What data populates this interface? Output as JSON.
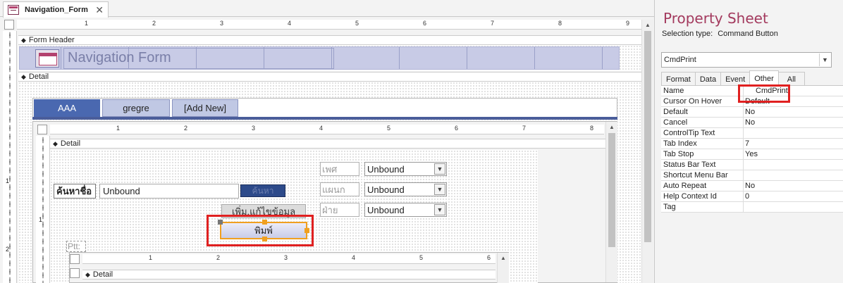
{
  "document_tab": {
    "title": "Navigation_Form",
    "close": "✕"
  },
  "ruler_numbers": [
    "1",
    "2",
    "3",
    "4",
    "5",
    "6",
    "7",
    "8",
    "9"
  ],
  "inner_ruler_numbers": [
    "1",
    "2",
    "3",
    "4",
    "5",
    "6",
    "7",
    "8"
  ],
  "sub_ruler_numbers": [
    "1",
    "2",
    "3",
    "4",
    "5",
    "6"
  ],
  "vruler_numbers": [
    "1",
    "2"
  ],
  "inner_vruler_numbers": [
    "1"
  ],
  "sections": {
    "form_header": "Form Header",
    "detail": "Detail",
    "inner_detail": "Detail",
    "sub_detail": "Detail"
  },
  "form_title": "Navigation Form",
  "nav_tabs": [
    "AAA",
    "gregre",
    "[Add New]"
  ],
  "subform": {
    "search_label": "ค้นหาชื่อ",
    "search_value": "Unbound",
    "search_button": "ค้นหา",
    "edit_button": "เพิ่ม,แก้ไขข้อมูล",
    "print_button": "พิมพ์",
    "pt_label": "Ptt:",
    "combos": [
      {
        "label": "เพศ",
        "value": "Unbound"
      },
      {
        "label": "แผนก",
        "value": "Unbound"
      },
      {
        "label": "ฝ่าย",
        "value": "Unbound"
      }
    ]
  },
  "property_sheet": {
    "title": "Property Sheet",
    "selection_type_label": "Selection type:",
    "selection_type_value": "Command Button",
    "selected_control": "CmdPrint",
    "tabs": [
      "Format",
      "Data",
      "Event",
      "Other",
      "All"
    ],
    "active_tab": "Other",
    "properties": [
      {
        "name": "Name",
        "value": "CmdPrint"
      },
      {
        "name": "Cursor On Hover",
        "value": "Default"
      },
      {
        "name": "Default",
        "value": "No"
      },
      {
        "name": "Cancel",
        "value": "No"
      },
      {
        "name": "ControlTip Text",
        "value": ""
      },
      {
        "name": "Tab Index",
        "value": "7"
      },
      {
        "name": "Tab Stop",
        "value": "Yes"
      },
      {
        "name": "Status Bar Text",
        "value": ""
      },
      {
        "name": "Shortcut Menu Bar",
        "value": ""
      },
      {
        "name": "Auto Repeat",
        "value": "No"
      },
      {
        "name": "Help Context Id",
        "value": "0"
      },
      {
        "name": "Tag",
        "value": ""
      }
    ]
  },
  "colors": {
    "accent": "#a33a5e",
    "nav_active": "#4a68b0",
    "highlight": "#e02020",
    "selection": "#f0a020"
  }
}
